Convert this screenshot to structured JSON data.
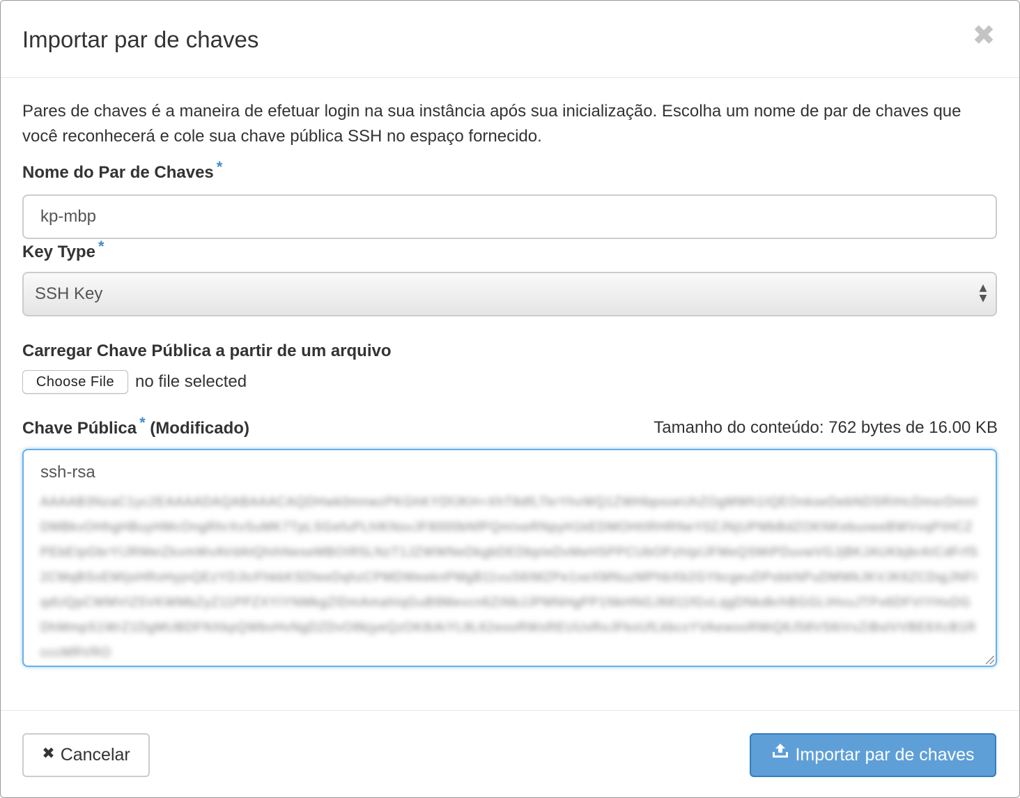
{
  "modal": {
    "title": "Importar par de chaves",
    "close_glyph": "✖"
  },
  "help_text": "Pares de chaves é a maneira de efetuar login na sua instância após sua inicialização. Escolha um nome de par de chaves que você reconhecerá e cole sua chave pública SSH no espaço fornecido.",
  "fields": {
    "keypair_name": {
      "label": "Nome do Par de Chaves",
      "required_mark": "*",
      "value": "kp-mbp"
    },
    "key_type": {
      "label": "Key Type",
      "required_mark": "*",
      "selected": "SSH Key"
    },
    "file_upload": {
      "label": "Carregar Chave Pública a partir de um arquivo",
      "button_label": "Choose File",
      "status": "no file selected"
    },
    "public_key": {
      "label": "Chave Pública",
      "required_mark": "*",
      "modified_note": "(Modificado)",
      "size_info": "Tamanho do conteúdo: 762 bytes de 16.00 KB",
      "first_line": "ssh-rsa",
      "blurred_content": "AAAAB3NzaC1yc2EAAAADAQABAAACAQDHwk0mnwzPKGhKYDfJKH+XhT8dfLTkrYhvWQ1ZWHbpsoeUhZOgMWh1IQEOnkseDebNDSRIHcDmsrDmnIDMBkvOHhgHBuyHMcOngRhrXvSuMK7TpLSGefuPLhlKNsvJF8000bNfPQmIxeRNpyH1kEDMOHtIRHRNeY0ZJNjUPMbBdZOKNKebuoeeBWVvqPIHCZPEbEIpGbrYIJRMeiZkxmWvAVdAtQhihNeseMBOIR5LNzT1JZWWNeDkgbDEDbpIeDvMeHSPPCUbOPzhIpIJFMeQSMiPDuvwVGJjBKJAUKbjbrAICdFrfS2CMqBSxEMIjsHRoHyjnQEzYDJtcFhkkKSDleeDqhzCPMDWeeknPMgB11vuS6IMZPe1xeXMNuzMPhbXb2GYbcgeuDPsbkNPuDMWkJKVJK6ZCDqjJNFIqdUQpCWMVIZ5VKWMbZyZ11PPZXYIYNMkgZlDmAmahIqGuB9Mevcn6ZiNbJJPMNHgPP1NkHNGJ6811fGvLqgDNkdkrhBGGLIHvuJTPx6DFVIYHxDGDhMmpS1WrZ1DgMUBDFNXkpQWbvHvNgDZDvO8kjyeQzOK8iAiYL8L62eooRWxREUUxRoJFkoUfLkbcxYVAewooRMiQ6J58VS6iVxZiBslVVBE6XcB1RcccMRVRO"
    }
  },
  "footer": {
    "cancel_label": "Cancelar",
    "import_label": "Importar par de chaves"
  },
  "colors": {
    "primary": "#5e9fd8",
    "required": "#428bca",
    "focus_border": "#66afe9"
  },
  "icons": {
    "close": "close-icon",
    "cancel": "x-icon",
    "import": "upload-icon",
    "select": "select-arrows-icon"
  }
}
